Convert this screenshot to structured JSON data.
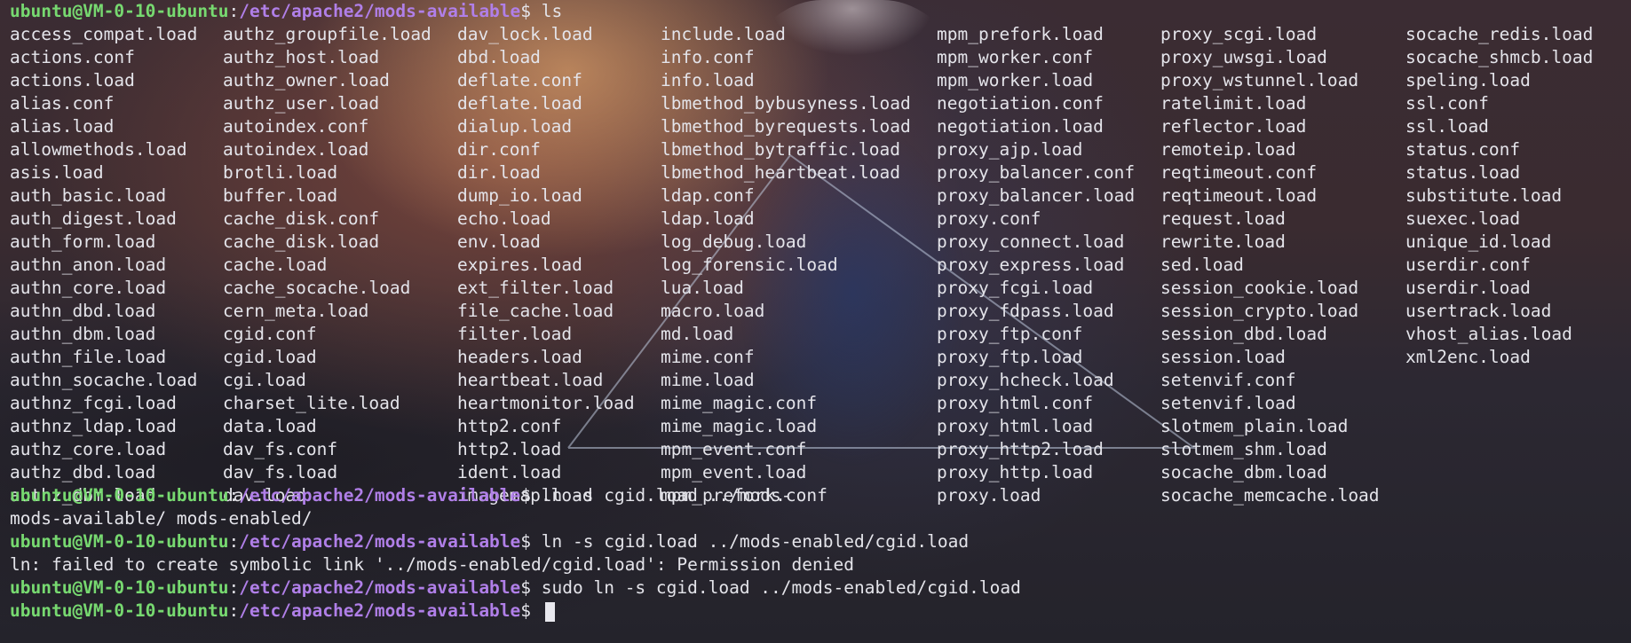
{
  "terminal": {
    "prompt": {
      "user_host": "ubuntu@VM-0-10-ubuntu",
      "colon": ":",
      "path": "/etc/apache2/mods-available",
      "dollar": "$"
    },
    "first_command": " ls",
    "listing_columns": [
      [
        "access_compat.load",
        "actions.conf",
        "actions.load",
        "alias.conf",
        "alias.load",
        "allowmethods.load",
        "asis.load",
        "auth_basic.load",
        "auth_digest.load",
        "auth_form.load",
        "authn_anon.load",
        "authn_core.load",
        "authn_dbd.load",
        "authn_dbm.load",
        "authn_file.load",
        "authn_socache.load",
        "authnz_fcgi.load",
        "authnz_ldap.load",
        "authz_core.load",
        "authz_dbd.load",
        "authz_dbm.load"
      ],
      [
        "authz_groupfile.load",
        "authz_host.load",
        "authz_owner.load",
        "authz_user.load",
        "autoindex.conf",
        "autoindex.load",
        "brotli.load",
        "buffer.load",
        "cache_disk.conf",
        "cache_disk.load",
        "cache.load",
        "cache_socache.load",
        "cern_meta.load",
        "cgid.conf",
        "cgid.load",
        "cgi.load",
        "charset_lite.load",
        "data.load",
        "dav_fs.conf",
        "dav_fs.load",
        "dav.load"
      ],
      [
        "dav_lock.load",
        "dbd.load",
        "deflate.conf",
        "deflate.load",
        "dialup.load",
        "dir.conf",
        "dir.load",
        "dump_io.load",
        "echo.load",
        "env.load",
        "expires.load",
        "ext_filter.load",
        "file_cache.load",
        "filter.load",
        "headers.load",
        "heartbeat.load",
        "heartmonitor.load",
        "http2.conf",
        "http2.load",
        "ident.load",
        "imagemap.load"
      ],
      [
        "include.load",
        "info.conf",
        "info.load",
        "lbmethod_bybusyness.load",
        "lbmethod_byrequests.load",
        "lbmethod_bytraffic.load",
        "lbmethod_heartbeat.load",
        "ldap.conf",
        "ldap.load",
        "log_debug.load",
        "log_forensic.load",
        "lua.load",
        "macro.load",
        "md.load",
        "mime.conf",
        "mime.load",
        "mime_magic.conf",
        "mime_magic.load",
        "mpm_event.conf",
        "mpm_event.load",
        "mpm_prefork.conf"
      ],
      [
        "mpm_prefork.load",
        "mpm_worker.conf",
        "mpm_worker.load",
        "negotiation.conf",
        "negotiation.load",
        "proxy_ajp.load",
        "proxy_balancer.conf",
        "proxy_balancer.load",
        "proxy.conf",
        "proxy_connect.load",
        "proxy_express.load",
        "proxy_fcgi.load",
        "proxy_fdpass.load",
        "proxy_ftp.conf",
        "proxy_ftp.load",
        "proxy_hcheck.load",
        "proxy_html.conf",
        "proxy_html.load",
        "proxy_http2.load",
        "proxy_http.load",
        "proxy.load"
      ],
      [
        "proxy_scgi.load",
        "proxy_uwsgi.load",
        "proxy_wstunnel.load",
        "ratelimit.load",
        "reflector.load",
        "remoteip.load",
        "reqtimeout.conf",
        "reqtimeout.load",
        "request.load",
        "rewrite.load",
        "sed.load",
        "session_cookie.load",
        "session_crypto.load",
        "session_dbd.load",
        "session.load",
        "setenvif.conf",
        "setenvif.load",
        "slotmem_plain.load",
        "slotmem_shm.load",
        "socache_dbm.load",
        "socache_memcache.load"
      ],
      [
        "socache_redis.load",
        "socache_shmcb.load",
        "speling.load",
        "ssl.conf",
        "ssl.load",
        "status.conf",
        "status.load",
        "substitute.load",
        "suexec.load",
        "unique_id.load",
        "userdir.conf",
        "userdir.load",
        "usertrack.load",
        "vhost_alias.load",
        "xml2enc.load"
      ]
    ],
    "second_command": " ln -s cgid.load ../mods-",
    "completion_line": "mods-available/ mods-enabled/",
    "third_command": " ln -s cgid.load ../mods-enabled/cgid.load",
    "error_line": "ln: failed to create symbolic link '../mods-enabled/cgid.load': Permission denied",
    "fourth_command": " sudo ln -s cgid.load ../mods-enabled/cgid.load",
    "final_command": " "
  }
}
